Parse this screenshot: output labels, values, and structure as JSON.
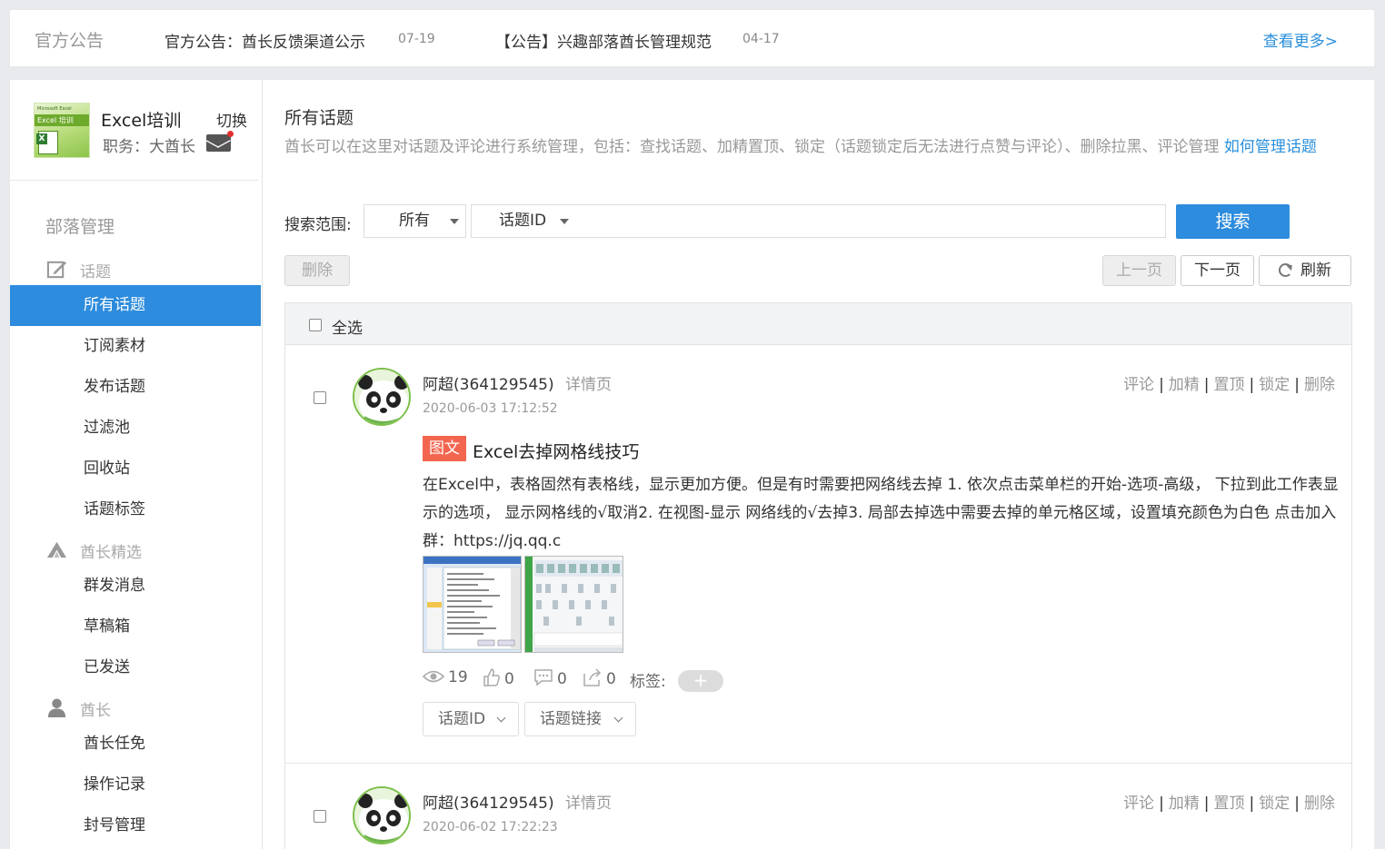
{
  "notice": {
    "title": "官方公告",
    "items": [
      {
        "text": "官方公告：酋长反馈渠道公示",
        "date": "07-19"
      },
      {
        "text": "【公告】兴趣部落酋长管理规范",
        "date": "04-17"
      }
    ],
    "more": "查看更多>"
  },
  "tribe": {
    "logo_top": "Microsoft Excel",
    "logo_band": "Excel 培训",
    "name": "Excel培训",
    "switch": "切换",
    "role": "职务：大酋长"
  },
  "sidebar": {
    "heading": "部落管理",
    "groups": {
      "topics": "话题",
      "select": "酋长精选",
      "chief": "酋长"
    },
    "items": {
      "all_topics": "所有话题",
      "subscribe": "订阅素材",
      "publish": "发布话题",
      "filter": "过滤池",
      "recycle": "回收站",
      "tags": "话题标签",
      "broadcast": "群发消息",
      "drafts": "草稿箱",
      "sent": "已发送",
      "appoint": "酋长任免",
      "logs": "操作记录",
      "ban": "封号管理"
    }
  },
  "content": {
    "title": "所有话题",
    "desc": "酋长可以在这里对话题及评论进行系统管理，包括：查找话题、加精置顶、锁定（话题锁定后无法进行点赞与评论）、删除拉黑、评论管理 ",
    "desc_link": "如何管理话题",
    "search_label": "搜索范围:",
    "scope": "所有",
    "field": "话题ID",
    "search_btn": "搜索",
    "delete_btn": "删除",
    "prev_btn": "上一页",
    "next_btn": "下一页",
    "refresh_btn": "刷新",
    "select_all": "全选"
  },
  "actions": {
    "comment": "评论",
    "elite": "加精",
    "top": "置顶",
    "lock": "锁定",
    "delete": "删除",
    "sep": "|"
  },
  "posts": [
    {
      "author": "阿超(364129545)",
      "detail": "详情页",
      "time": "2020-06-03 17:12:52",
      "badge": "图文",
      "title": "Excel去掉网格线技巧",
      "body": "在Excel中，表格固然有表格线，显示更加方便。但是有时需要把网络线去掉 1. 依次点击菜单栏的开始-选项-高级， 下拉到此工作表显示的选项， 显示网格线的√取消2. 在视图-显示 网络线的√去掉3. 局部去掉选中需要去掉的单元格区域，设置填充颜色为白色 点击加入群：https://jq.qq.c",
      "views": "19",
      "likes": "0",
      "comments": "0",
      "shares": "0",
      "tags_label": "标签:",
      "tag_add": "+",
      "btn_id": "话题ID",
      "btn_link": "话题链接"
    },
    {
      "author": "阿超(364129545)",
      "detail": "详情页",
      "time": "2020-06-02 17:22:23"
    }
  ]
}
